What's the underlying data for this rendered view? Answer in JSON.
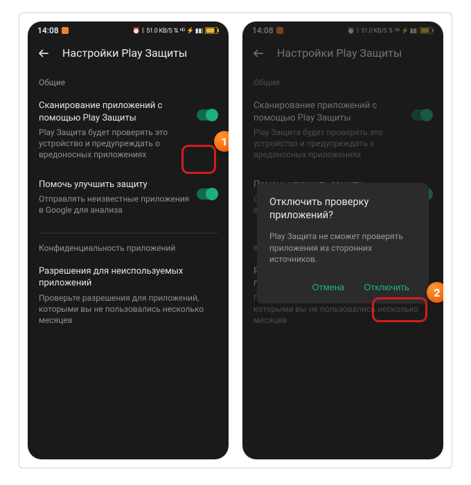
{
  "statusbar": {
    "time": "14:08",
    "right_text": "⏰ ᛒ 51.0 KB/S ⇅ ᴴᴰ ⚡ ▮▮|",
    "battery_color": "#e4b730"
  },
  "header": {
    "title": "Настройки Play Защиты"
  },
  "sections": {
    "general": "Общие",
    "privacy": "Конфиденциальность приложений"
  },
  "settings": {
    "scan": {
      "title": "Сканирование приложений с помощью Play Защиты",
      "desc": "Play Защита будет проверять это устройство и предупреждать о вредоносных приложениях"
    },
    "improve": {
      "title": "Помочь улучшить защиту",
      "desc": "Отправлять неизвестные приложения в Google для анализа"
    },
    "unused": {
      "title": "Разрешения для неиспользуемых приложений",
      "desc": "Проверьте разрешения для приложений, которыми вы не пользовались несколько месяцев"
    }
  },
  "dialog": {
    "title": "Отключить проверку приложений?",
    "body": "Play Защита не сможет проверять приложения из сторонних источников.",
    "cancel": "Отмена",
    "confirm": "Отключить"
  },
  "steps": {
    "one": "1",
    "two": "2"
  }
}
